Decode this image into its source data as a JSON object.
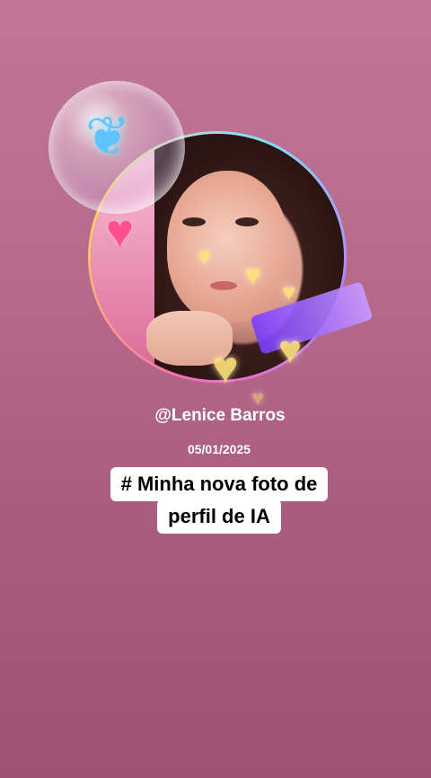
{
  "profile": {
    "username": "@Lenice Barros",
    "date": "05/01/2025"
  },
  "caption": {
    "line1": "# Minha nova foto de",
    "line2": "perfil de IA"
  },
  "icons": {
    "butterfly": "butterfly-icon",
    "heart": "heart-icon"
  },
  "colors": {
    "background_top": "#c27697",
    "background_bottom": "#9e5274",
    "caption_box": "#ffffff",
    "text_light": "#ffffff"
  }
}
